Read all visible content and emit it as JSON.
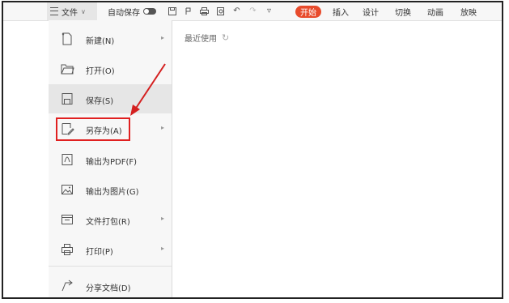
{
  "toolbar": {
    "file_label": "文件",
    "autosave_label": "自动保存",
    "tabs": {
      "start": "开始",
      "insert": "插入",
      "design": "设计",
      "transition": "切换",
      "animation": "动画",
      "slideshow": "放映"
    },
    "icons": [
      "save-icon",
      "cloud-icon",
      "print-icon",
      "preview-icon",
      "undo-icon",
      "redo-icon",
      "more-icon"
    ]
  },
  "menu": {
    "items": [
      {
        "label": "新建(N)",
        "icon": "new-file-icon",
        "submenu": true
      },
      {
        "label": "打开(O)",
        "icon": "folder-icon",
        "submenu": false
      },
      {
        "label": "保存(S)",
        "icon": "save-icon",
        "submenu": false
      },
      {
        "label": "另存为(A)",
        "icon": "save-as-icon",
        "submenu": true
      },
      {
        "label": "输出为PDF(F)",
        "icon": "pdf-icon",
        "submenu": false
      },
      {
        "label": "输出为图片(G)",
        "icon": "image-icon",
        "submenu": false
      },
      {
        "label": "文件打包(R)",
        "icon": "package-icon",
        "submenu": true
      },
      {
        "label": "打印(P)",
        "icon": "printer-icon",
        "submenu": true
      },
      {
        "label": "分享文档(D)",
        "icon": "share-icon",
        "submenu": false
      }
    ]
  },
  "recent": {
    "label": "最近使用"
  },
  "colors": {
    "start_tab": "#e84b2c",
    "highlight": "#e02020",
    "arrow": "#d42020"
  }
}
